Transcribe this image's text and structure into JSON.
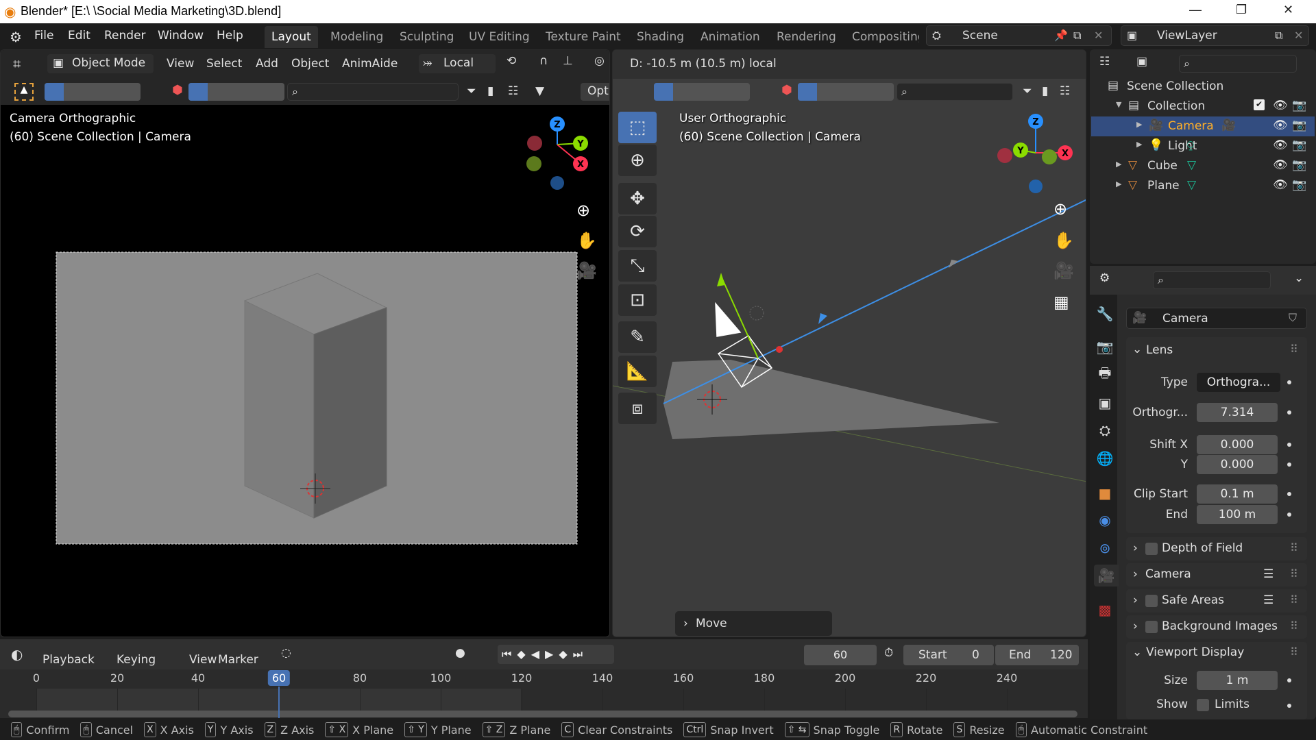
{
  "window": {
    "title": "Blender* [E:\\ \\Social Media Marketing\\3D.blend]"
  },
  "menu": {
    "items": [
      "File",
      "Edit",
      "Render",
      "Window",
      "Help"
    ]
  },
  "workspaces": {
    "tabs": [
      "Layout",
      "Modeling",
      "Sculpting",
      "UV Editing",
      "Texture Paint",
      "Shading",
      "Animation",
      "Rendering",
      "Compositing"
    ],
    "active": "Layout"
  },
  "scene": {
    "name": "Scene"
  },
  "view_layer": {
    "name": "ViewLayer"
  },
  "left_viewport": {
    "mode": "Object Mode",
    "menus": [
      "View",
      "Select",
      "Add",
      "Object",
      "AnimAide"
    ],
    "orientation": "Local",
    "options_label": "Opti",
    "view_name": "Camera Orthographic",
    "info": "(60) Scene Collection | Camera"
  },
  "right_viewport": {
    "operator_readout": "D: -10.5 m (10.5 m) local",
    "view_name": "User Orthographic",
    "info": "(60) Scene Collection | Camera",
    "last_operator": "Move",
    "gizmo": {
      "x": "X",
      "y": "Y",
      "z": "Z"
    }
  },
  "outliner": {
    "rows": [
      {
        "label": "Scene Collection",
        "icon": "collection-icon",
        "depth": 0
      },
      {
        "label": "Collection",
        "icon": "collection-icon",
        "depth": 1
      },
      {
        "label": "Camera",
        "icon": "camera-object-icon",
        "depth": 2,
        "selected": true
      },
      {
        "label": "Light",
        "icon": "light-object-icon",
        "depth": 2
      },
      {
        "label": "Cube",
        "icon": "mesh-object-icon",
        "depth": 1
      },
      {
        "label": "Plane",
        "icon": "mesh-object-icon",
        "depth": 1
      }
    ]
  },
  "properties": {
    "datablock": "Camera",
    "lens": {
      "title": "Lens",
      "type_label": "Type",
      "type_value": "Orthogra...",
      "ortho_label": "Orthogr...",
      "ortho_value": "7.314",
      "shift_x_label": "Shift X",
      "shift_x": "0.000",
      "shift_y_label": "Y",
      "shift_y": "0.000",
      "clip_start_label": "Clip Start",
      "clip_start": "0.1 m",
      "clip_end_label": "End",
      "clip_end": "100 m"
    },
    "panels": [
      "Depth of Field",
      "Camera",
      "Safe Areas",
      "Background Images"
    ],
    "viewport_display": {
      "title": "Viewport Display",
      "size_label": "Size",
      "size": "1 m",
      "show_label": "Show",
      "limits_label": "Limits"
    }
  },
  "timeline": {
    "menus": [
      "Playback",
      "Keying",
      "View",
      "Marker"
    ],
    "current_frame": "60",
    "start_label": "Start",
    "start": "0",
    "end_label": "End",
    "end": "120",
    "ticks": [
      "0",
      "20",
      "40",
      "60",
      "80",
      "100",
      "120",
      "140",
      "160",
      "180",
      "200",
      "220",
      "240"
    ]
  },
  "statusbar": {
    "items": [
      {
        "key": "",
        "label": "Confirm"
      },
      {
        "key": "",
        "label": "Cancel"
      },
      {
        "key": "X",
        "label": "X Axis"
      },
      {
        "key": "Y",
        "label": "Y Axis"
      },
      {
        "key": "Z",
        "label": "Z Axis"
      },
      {
        "key": "⇧ X",
        "label": "X Plane"
      },
      {
        "key": "⇧ Y",
        "label": "Y Plane"
      },
      {
        "key": "⇧ Z",
        "label": "Z Plane"
      },
      {
        "key": "C",
        "label": "Clear Constraints"
      },
      {
        "key": "Ctrl",
        "label": "Snap Invert"
      },
      {
        "key": "⇧ ⇆",
        "label": "Snap Toggle"
      },
      {
        "key": "R",
        "label": "Rotate"
      },
      {
        "key": "S",
        "label": "Resize"
      },
      {
        "key": "",
        "label": "Automatic Constraint"
      }
    ]
  },
  "colors": {
    "accent": "#4772b3",
    "selected_row": "#334d80",
    "active_text": "#ffaf29",
    "x_axis": "#ff3352",
    "y_axis": "#8bdc00",
    "z_axis": "#2890ff"
  }
}
